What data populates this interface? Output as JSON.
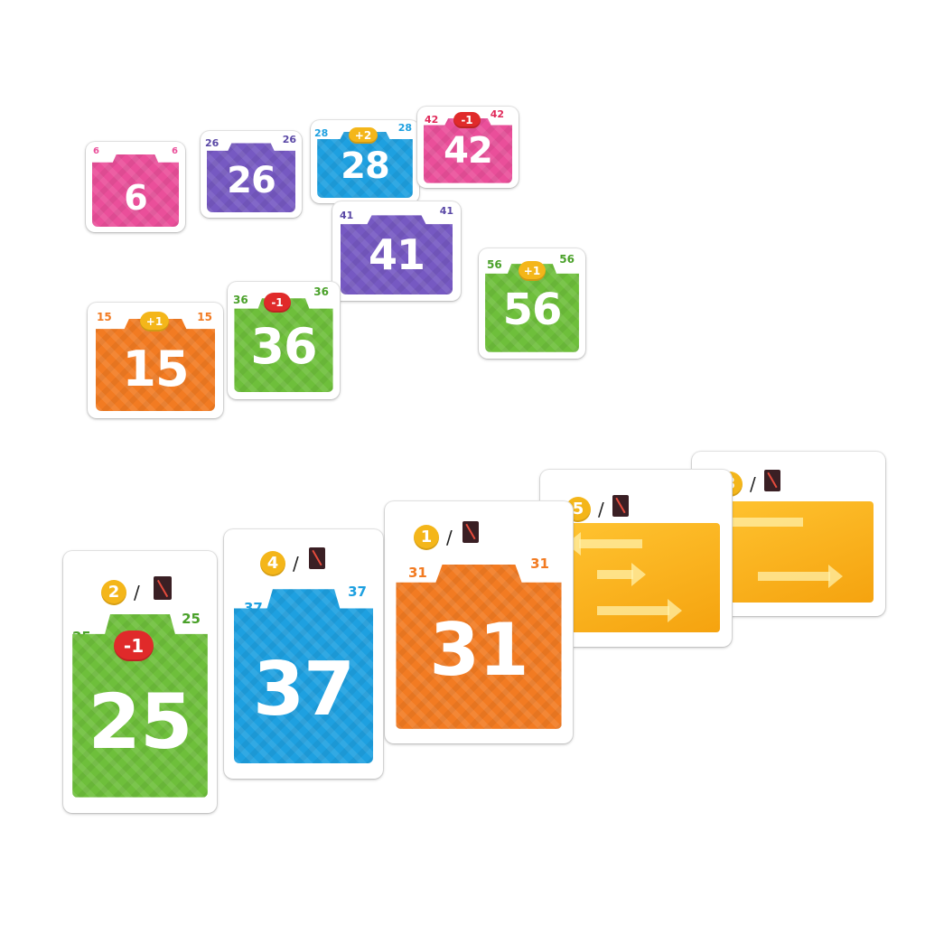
{
  "colors": {
    "pink": "#ea4f9a",
    "purple": "#7659c2",
    "blue": "#1ea0e0",
    "orange": "#f27b22",
    "green": "#6ebf3b",
    "gold": "#f4b61a",
    "red": "#e02a2a"
  },
  "board_cards": [
    {
      "id": "c6",
      "number": "6",
      "corner": "6",
      "color": "pink",
      "modifier": ""
    },
    {
      "id": "c26",
      "number": "26",
      "corner": "26",
      "color": "purple",
      "modifier": ""
    },
    {
      "id": "c28",
      "number": "28",
      "corner": "28",
      "color": "blue",
      "modifier": "+2",
      "corner_mod": "1"
    },
    {
      "id": "c42",
      "number": "42",
      "corner": "42",
      "color": "pink",
      "modifier": "-1",
      "corner_mod": "1"
    },
    {
      "id": "c41",
      "number": "41",
      "corner": "41",
      "color": "purple",
      "modifier": ""
    },
    {
      "id": "c56",
      "number": "56",
      "corner": "56",
      "color": "green",
      "modifier": "+1",
      "corner_mod": "1"
    },
    {
      "id": "c15",
      "number": "15",
      "corner": "15",
      "color": "orange",
      "modifier": "+1",
      "corner_mod": "1"
    },
    {
      "id": "c36",
      "number": "36",
      "corner": "36",
      "color": "green",
      "modifier": "-1",
      "corner_mod": "1"
    }
  ],
  "hand_cards": [
    {
      "id": "h25",
      "cost": "2",
      "number": "25",
      "corner": "25",
      "color": "green",
      "modifier": "-1",
      "corner_mod": "1"
    },
    {
      "id": "h37",
      "cost": "4",
      "number": "37",
      "corner": "37",
      "color": "blue",
      "modifier": ""
    },
    {
      "id": "h31",
      "cost": "1",
      "number": "31",
      "corner": "31",
      "color": "orange",
      "modifier": ""
    },
    {
      "id": "h5",
      "cost": "5",
      "type": "arrows"
    },
    {
      "id": "h3",
      "cost": "3",
      "type": "arrows"
    }
  ],
  "slash": "/"
}
